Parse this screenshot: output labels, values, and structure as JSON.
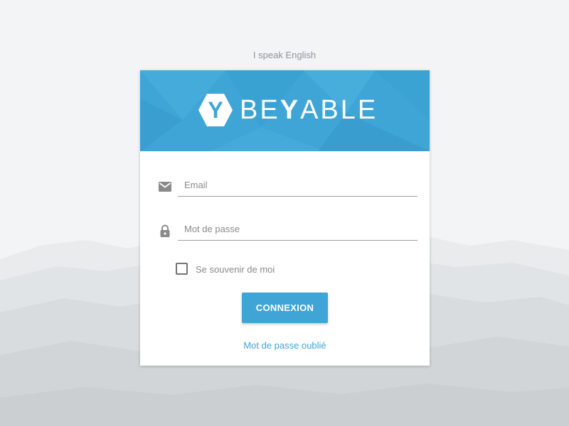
{
  "language_link": "I speak English",
  "logo": {
    "mark_letter": "Y",
    "text_pre": "BE",
    "text_mid": "Y",
    "text_post": "ABLE"
  },
  "form": {
    "email_placeholder": "Email",
    "password_placeholder": "Mot de passe",
    "remember_label": "Se souvenir de moi",
    "remember_checked": false,
    "submit_label": "CONNEXION",
    "forgot_link": "Mot de passe oublié"
  },
  "icons": {
    "email": "email-icon",
    "password": "lock-icon",
    "logo": "hexagon-logo-icon"
  },
  "colors": {
    "accent": "#3ea5d6",
    "background": "#f3f4f5",
    "card": "#ffffff",
    "muted_text": "#8f9498"
  }
}
